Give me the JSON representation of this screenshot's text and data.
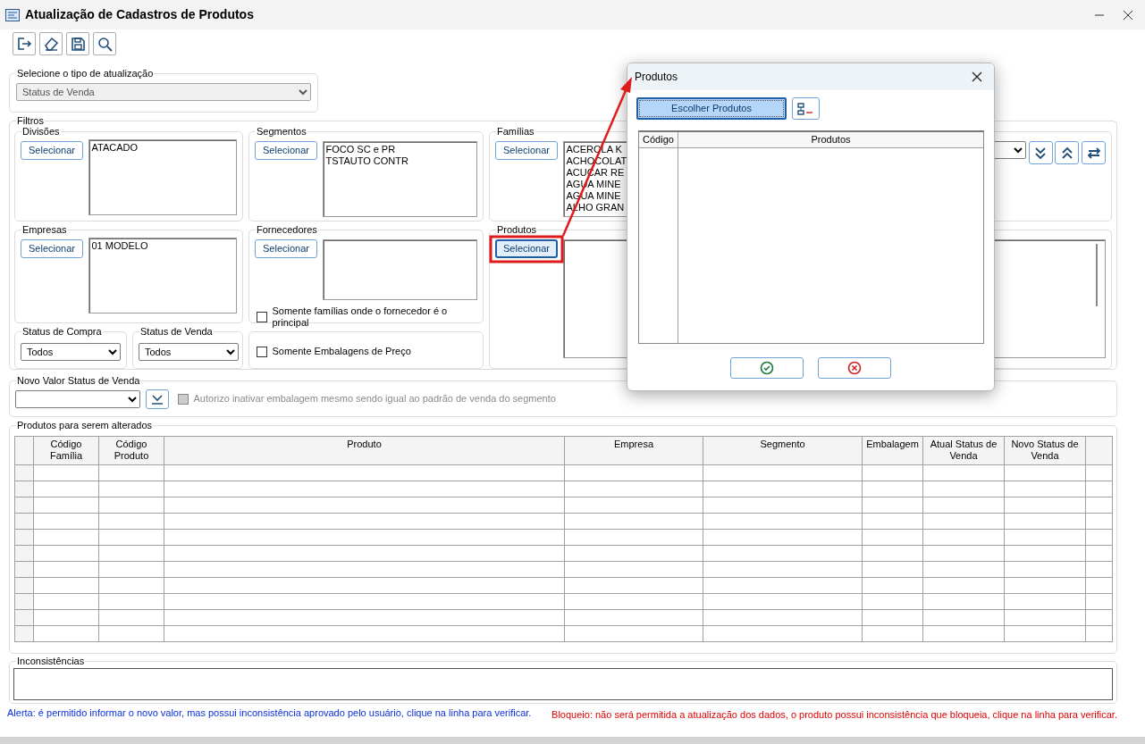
{
  "window": {
    "title": "Atualização de Cadastros de Produtos"
  },
  "toolbar": [
    {
      "kind": "exit"
    },
    {
      "kind": "eraser"
    },
    {
      "kind": "save"
    },
    {
      "kind": "search"
    }
  ],
  "update_type": {
    "label": "Selecione o tipo de atualização",
    "value": "Status de Venda",
    "disabled": true
  },
  "filters": {
    "label": "Filtros",
    "groups": [
      {
        "kind": "picker",
        "label": "Divisões",
        "button": "Selecionar",
        "items": [
          "ATACADO"
        ]
      },
      {
        "kind": "picker",
        "label": "Segmentos",
        "button": "Selecionar",
        "items": [
          "FOCO SC e PR",
          "TSTAUTO CONTR"
        ]
      },
      {
        "kind": "picker",
        "label": "Famílias",
        "button": "Selecionar",
        "items": [
          "ACEROLA K",
          "ACHOCOLAT",
          "ACUCAR RE",
          "AGUA MINE",
          "AGUA MINE",
          "ALHO GRAN"
        ],
        "tools": [
          {
            "kind": "expand"
          },
          {
            "kind": "collapse"
          },
          {
            "kind": "swap"
          }
        ]
      },
      {
        "kind": "picker",
        "label": "Empresas",
        "button": "Selecionar",
        "items": [
          "01 MODELO"
        ]
      },
      {
        "kind": "picker",
        "label": "Fornecedores",
        "button": "Selecionar",
        "checkbox": {
          "label": "Somente famílias onde o fornecedor é o principal",
          "checked": false
        }
      },
      {
        "kind": "picker",
        "label": "Produtos",
        "button": "Selecionar",
        "highlighted": true
      },
      {
        "kind": "select",
        "label": "Status de Compra",
        "value": "Todos"
      },
      {
        "kind": "select",
        "label": "Status de Venda",
        "value": "Todos"
      },
      {
        "kind": "checkbox",
        "label": "Somente Embalagens de Preço",
        "checked": false
      }
    ]
  },
  "new_value": {
    "label": "Novo Valor Status de Venda",
    "checkbox": {
      "label": "Autorizo inativar embalagem mesmo sendo igual ao padrão de venda do segmento",
      "checked": false,
      "disabled": true
    }
  },
  "products_grid": {
    "label": "Produtos para serem alterados",
    "columns": [
      "Código Família",
      "Código Produto",
      "Produto",
      "Empresa",
      "Segmento",
      "Embalagem",
      "Atual Status de Venda",
      "Novo Status de Venda"
    ]
  },
  "inconsistencies": {
    "label": "Inconsistências"
  },
  "footer": [
    {
      "kind": "alert",
      "text": "Alerta: é permitido informar o novo valor, mas possui inconsistência aprovado pelo usuário, clique na linha para verificar."
    },
    {
      "kind": "block",
      "text": "Bloqueio: não será permitida a atualização dos dados, o produto possui inconsistência que bloqueia, clique na linha para verificar."
    }
  ],
  "dialog": {
    "title": "Produtos",
    "button": "Escolher Produtos",
    "columns": [
      "Código",
      "Produtos"
    ]
  }
}
